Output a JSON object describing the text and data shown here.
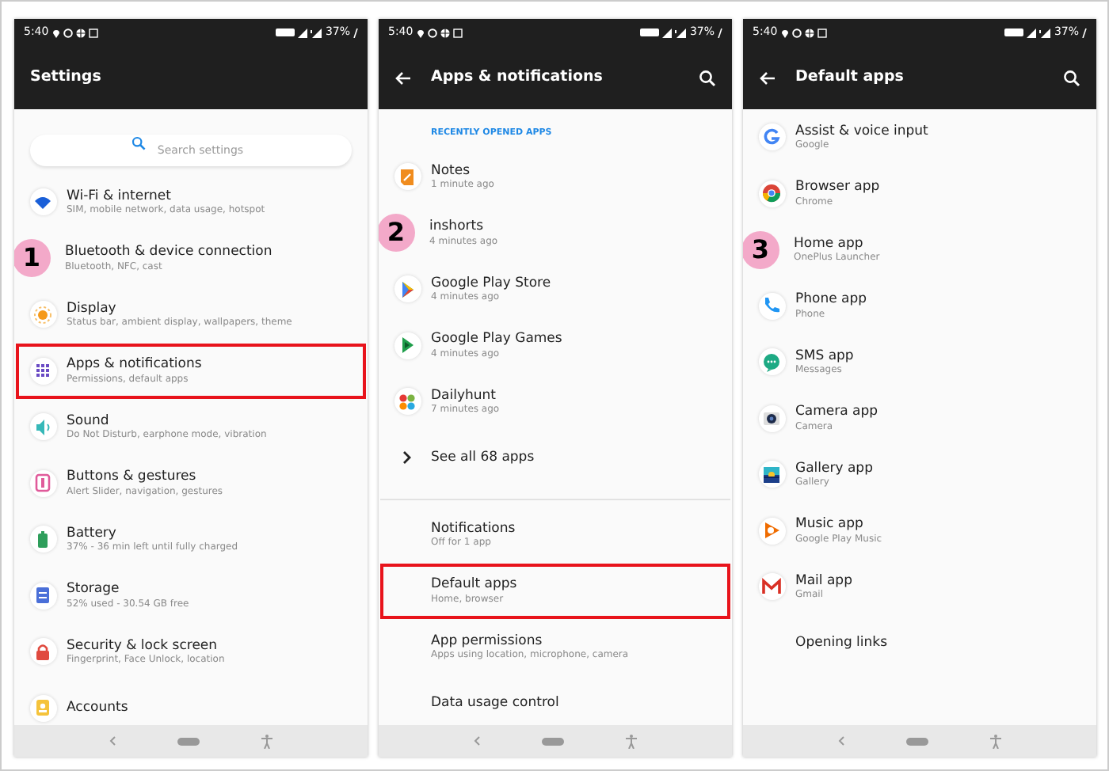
{
  "screens": [
    {
      "status": {
        "time": "5:40",
        "battery": "37%"
      },
      "title": "Settings",
      "back_button": false,
      "search_button": false,
      "search_field": {
        "placeholder": "Search settings"
      },
      "step": "1",
      "items": [
        {
          "kind": "app",
          "title": "Wi-Fi & internet",
          "subtitle": "SIM, mobile network, data usage, hotspot",
          "highlighted": false
        },
        {
          "kind": "app",
          "title": "Bluetooth & device connection",
          "subtitle": "Bluetooth, NFC, cast",
          "highlighted": false
        },
        {
          "kind": "app",
          "title": "Display",
          "subtitle": "Status bar, ambient display, wallpapers, theme",
          "highlighted": false
        },
        {
          "kind": "app",
          "title": "Apps & notifications",
          "subtitle": "Permissions, default apps",
          "highlighted": true
        },
        {
          "kind": "app",
          "title": "Sound",
          "subtitle": "Do Not Disturb, earphone mode, vibration",
          "highlighted": false
        },
        {
          "kind": "app",
          "title": "Buttons & gestures",
          "subtitle": "Alert Slider, navigation, gestures",
          "highlighted": false
        },
        {
          "kind": "app",
          "title": "Battery",
          "subtitle": "37% - 36 min left until fully charged",
          "highlighted": false
        },
        {
          "kind": "app",
          "title": "Storage",
          "subtitle": "52% used - 30.54 GB free",
          "highlighted": false
        },
        {
          "kind": "app",
          "title": "Security & lock screen",
          "subtitle": "Fingerprint, Face Unlock, location",
          "highlighted": false
        },
        {
          "kind": "app",
          "title": "Accounts",
          "highlighted": false
        }
      ]
    },
    {
      "status": {
        "time": "5:40",
        "battery": "37%"
      },
      "title": "Apps & notifications",
      "back_button": true,
      "search_button": true,
      "step": "2",
      "items": [
        {
          "kind": "section_header",
          "title": "RECENTLY OPENED APPS"
        },
        {
          "kind": "app",
          "title": "Notes",
          "subtitle": "1 minute ago",
          "highlighted": false
        },
        {
          "kind": "app",
          "title": "inshorts",
          "subtitle": "4 minutes ago",
          "highlighted": false
        },
        {
          "kind": "app",
          "title": "Google Play Store",
          "subtitle": "4 minutes ago",
          "highlighted": false
        },
        {
          "kind": "app",
          "title": "Google Play Games",
          "subtitle": "4 minutes ago",
          "highlighted": false
        },
        {
          "kind": "app",
          "title": "Dailyhunt",
          "subtitle": "7 minutes ago",
          "highlighted": false
        },
        {
          "kind": "more",
          "title": "See all 68 apps",
          "highlighted": false
        },
        {
          "kind": "divider"
        },
        {
          "kind": "plain",
          "title": "Notifications",
          "subtitle": "Off for 1 app",
          "highlighted": false
        },
        {
          "kind": "plain",
          "title": "Default apps",
          "subtitle": "Home, browser",
          "highlighted": true
        },
        {
          "kind": "plain",
          "title": "App permissions",
          "subtitle": "Apps using location, microphone, camera",
          "highlighted": false
        },
        {
          "kind": "plain",
          "title": "Data usage control",
          "highlighted": false
        }
      ]
    },
    {
      "status": {
        "time": "5:40",
        "battery": "37%"
      },
      "title": "Default apps",
      "back_button": true,
      "search_button": true,
      "step": "3",
      "items": [
        {
          "kind": "app",
          "title": "Assist & voice input",
          "subtitle": "Google",
          "highlighted": false
        },
        {
          "kind": "app",
          "title": "Browser app",
          "subtitle": "Chrome",
          "highlighted": false
        },
        {
          "kind": "app",
          "title": "Home app",
          "subtitle": "OnePlus Launcher",
          "highlighted": false
        },
        {
          "kind": "app",
          "title": "Phone app",
          "subtitle": "Phone",
          "highlighted": false
        },
        {
          "kind": "app",
          "title": "SMS app",
          "subtitle": "Messages",
          "highlighted": false
        },
        {
          "kind": "app",
          "title": "Camera app",
          "subtitle": "Camera",
          "highlighted": false
        },
        {
          "kind": "app",
          "title": "Gallery app",
          "subtitle": "Gallery",
          "highlighted": false
        },
        {
          "kind": "app",
          "title": "Music app",
          "subtitle": "Google Play Music",
          "highlighted": false
        },
        {
          "kind": "app",
          "title": "Mail app",
          "subtitle": "Gmail",
          "highlighted": false
        },
        {
          "kind": "plain",
          "title": "Opening links",
          "highlighted": false
        }
      ]
    }
  ]
}
